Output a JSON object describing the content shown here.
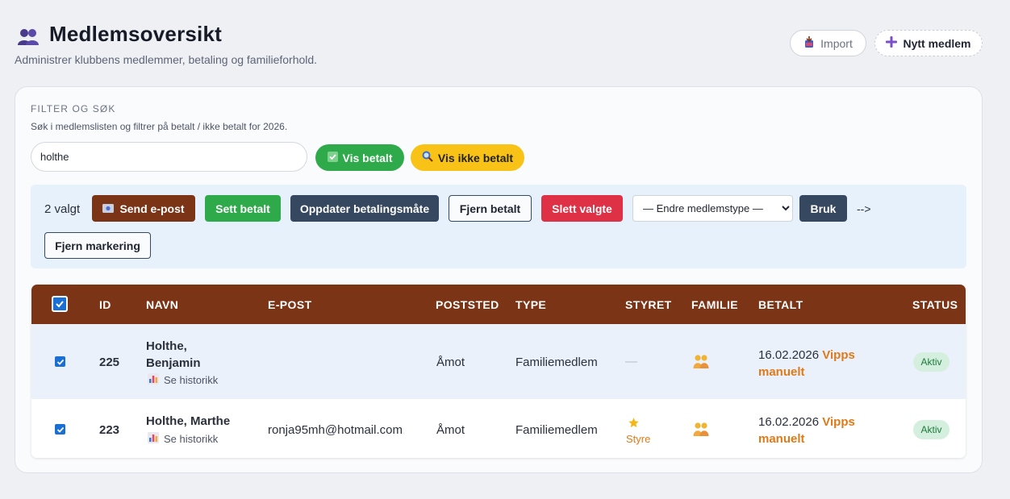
{
  "header": {
    "title": "Medlemsoversikt",
    "subtitle": "Administrer klubbens medlemmer, betaling og familieforhold.",
    "import_label": "Import",
    "new_member_label": "Nytt medlem"
  },
  "filter": {
    "heading": "FILTER OG SØK",
    "description": "Søk i medlemslisten og filtrer på betalt / ikke betalt for 2026.",
    "search_value": "holthe",
    "show_paid_label": "Vis betalt",
    "show_unpaid_label": "Vis ikke betalt"
  },
  "bulk": {
    "selected_count": "2 valgt",
    "send_email_label": "Send e-post",
    "set_paid_label": "Sett betalt",
    "update_payment_label": "Oppdater betalingsmåte",
    "remove_paid_label": "Fjern betalt",
    "delete_label": "Slett valgte",
    "member_type_select": "— Endre medlemstype —",
    "apply_label": "Bruk",
    "stray_text": "-->",
    "clear_selection_label": "Fjern markering"
  },
  "table": {
    "columns": [
      "ID",
      "NAVN",
      "E-POST",
      "POSTSTED",
      "TYPE",
      "STYRET",
      "FAMILIE",
      "BETALT",
      "STATUS"
    ],
    "rows": [
      {
        "id": "225",
        "name_line1": "Holthe,",
        "name_line2": "Benjamin",
        "history": "Se historikk",
        "email": "",
        "poststed": "Åmot",
        "type": "Familiemedlem",
        "board": "—",
        "paid_date": "16.02.2026",
        "paid_method_a": "Vipps",
        "paid_method_b": "manuelt",
        "status": "Aktiv"
      },
      {
        "id": "223",
        "name_line1": "Holthe, Marthe",
        "history": "Se historikk",
        "email": "ronja95mh@hotmail.com",
        "poststed": "Åmot",
        "type": "Familiemedlem",
        "board": "Styre",
        "paid_date": "16.02.2026",
        "paid_method_a": "Vipps",
        "paid_method_b": "manuelt",
        "status": "Aktiv"
      }
    ]
  },
  "colors": {
    "brand": "#7b3416",
    "success": "#2eaa4a",
    "warning": "#f8c316",
    "danger": "#de3146",
    "navy": "#364760",
    "accent_orange": "#e07a18"
  }
}
